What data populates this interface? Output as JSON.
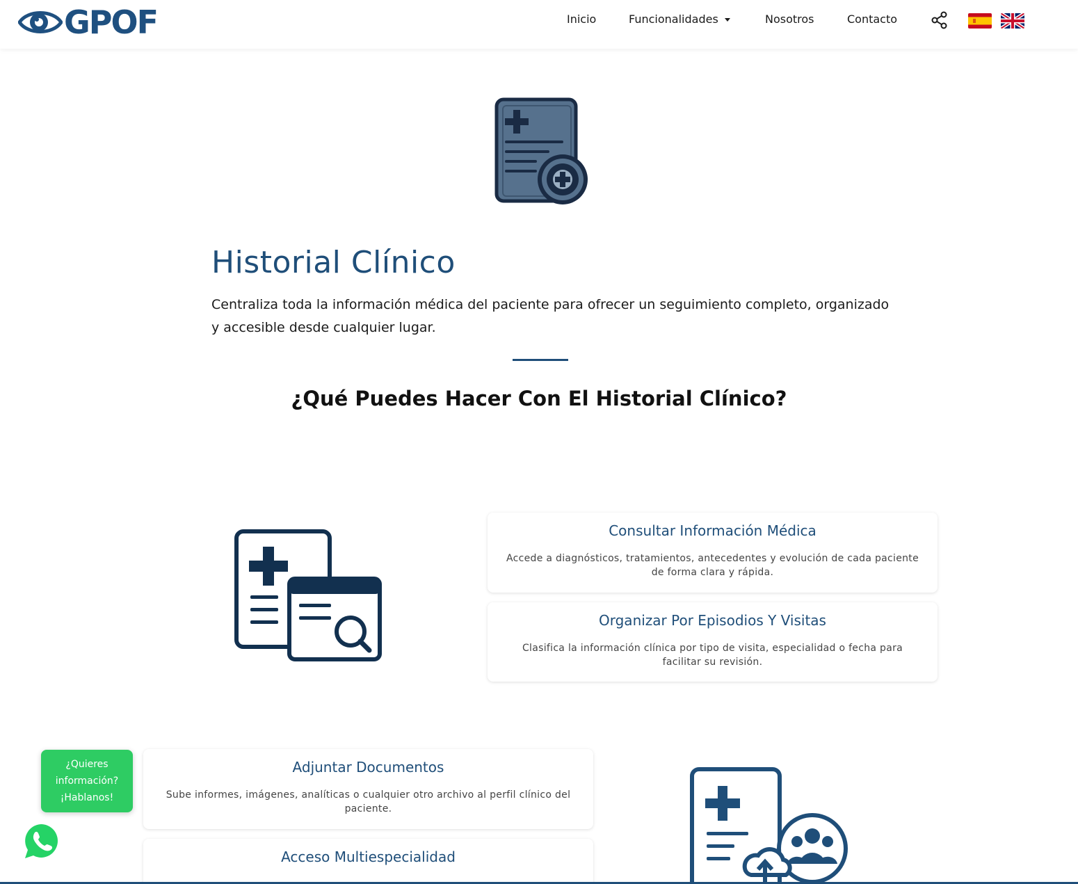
{
  "navbar": {
    "logo_text": "GPOF",
    "links": {
      "inicio": "Inicio",
      "funcionalidades": "Funcionalidades",
      "nosotros": "Nosotros",
      "contacto": "Contacto"
    }
  },
  "hero": {
    "title": "Historial Clínico",
    "description": "Centraliza toda la información médica del paciente para ofrecer un seguimiento completo, organizado y accesible desde cualquier lugar.",
    "section_title": "¿Qué Puedes Hacer Con El Historial Clínico?"
  },
  "features": [
    {
      "title": "Consultar Información Médica",
      "text": "Accede a diagnósticos, tratamientos, antecedentes y evolución de cada paciente de forma clara y rápida."
    },
    {
      "title": "Organizar Por Episodios Y Visitas",
      "text": "Clasifica la información clínica por tipo de visita, especialidad o fecha para facilitar su revisión."
    },
    {
      "title": "Adjuntar Documentos",
      "text": "Sube informes, imágenes, analíticas o cualquier otro archivo al perfil clínico del paciente."
    },
    {
      "title": "Acceso Multiespecialidad",
      "text": ""
    }
  ],
  "chat_bubble": {
    "line1": "¿Quieres",
    "line2": "información?",
    "line3": "¡Hablanos!"
  },
  "colors": {
    "brand": "#1f4e79",
    "whatsapp": "#2ecc63"
  },
  "icons": [
    "eye-logo-icon",
    "share-icon",
    "flag-es-icon",
    "flag-uk-icon",
    "medical-record-eye-icon",
    "medical-record-search-icon",
    "medical-record-upload-group-icon",
    "whatsapp-icon"
  ]
}
